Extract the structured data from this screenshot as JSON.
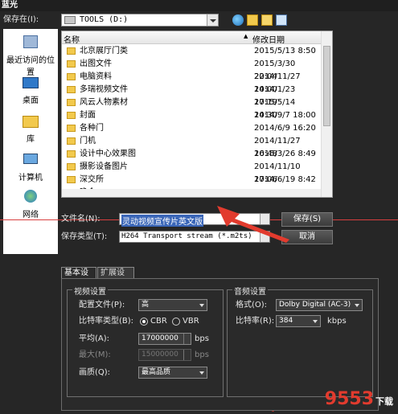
{
  "window": {
    "title": "蓝光"
  },
  "save_in": {
    "label": "保存在(I):",
    "value": "TOOLS (D:)"
  },
  "places": [
    {
      "label": "最近访问的位置",
      "icon": "recent-places-icon"
    },
    {
      "label": "桌面",
      "icon": "desktop-icon"
    },
    {
      "label": "库",
      "icon": "libraries-icon"
    },
    {
      "label": "计算机",
      "icon": "computer-icon"
    },
    {
      "label": "网络",
      "icon": "network-icon"
    }
  ],
  "file_list": {
    "columns": [
      "名称",
      "修改日期"
    ],
    "rows": [
      {
        "name": "北京展厅门类",
        "date": "2015/5/13 8:50"
      },
      {
        "name": "出图文件",
        "date": "2015/3/30 22:04"
      },
      {
        "name": "电脑资料",
        "date": "2014/11/27 14:00"
      },
      {
        "name": "多瑞视频文件",
        "date": "2014/1/23 17:19"
      },
      {
        "name": "风云人物素材",
        "date": "2015/5/14 14:30"
      },
      {
        "name": "封面",
        "date": "2014/9/7 18:00"
      },
      {
        "name": "各种门",
        "date": "2014/6/9 16:20"
      },
      {
        "name": "门机",
        "date": "2014/11/27 16:48"
      },
      {
        "name": "设计中心效果图",
        "date": "2015/3/26 8:49"
      },
      {
        "name": "摄影设备图片",
        "date": "2014/11/10 17:06"
      },
      {
        "name": "深交所",
        "date": "2014/6/19 8:42"
      },
      {
        "name": "晚会",
        "date": "2015/2/3 8:04"
      }
    ]
  },
  "filename": {
    "label": "文件名(N):",
    "value": "灵动视频宣传片英文版"
  },
  "filetype": {
    "label": "保存类型(T):",
    "value": "H264 Transport stream (*.m2ts)"
  },
  "buttons": {
    "save": "保存(S)",
    "cancel": "取消"
  },
  "tabs": [
    "基本设置",
    "扩展设置"
  ],
  "video": {
    "group_title": "视频设置",
    "profile_label": "配置文件(P):",
    "profile_value": "高",
    "bitrate_type_label": "比特率类型(B):",
    "cbr": "CBR",
    "vbr": "VBR",
    "avg_label": "平均(A):",
    "avg_value": "17000000",
    "avg_unit": "bps",
    "max_label": "最大(M):",
    "max_value": "15000000",
    "max_unit": "bps",
    "quality_label": "画质(Q):",
    "quality_value": "最高品质"
  },
  "audio": {
    "group_title": "音频设置",
    "format_label": "格式(O):",
    "format_value": "Dolby Digital (AC-3)",
    "bitrate_label": "比特率(R):",
    "bitrate_value": "384",
    "bitrate_unit": "kbps"
  },
  "watermark": {
    "text": "9553",
    "sub": "下载"
  },
  "colors": {
    "accent": "#e23b2e",
    "folder": "#f2c94c"
  }
}
